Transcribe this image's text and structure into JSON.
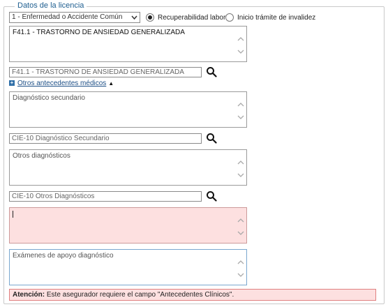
{
  "section": {
    "title": "Datos de la licencia"
  },
  "license_type": {
    "selected": "1 - Enfermedad o Accidente Común"
  },
  "radios": [
    {
      "label": "Recuperabilidad laboral",
      "checked": true
    },
    {
      "label": "Inicio trámite de invalidez",
      "checked": false
    }
  ],
  "primary_diagnosis": {
    "text": "F41.1 - TRASTORNO DE ANSIEDAD GENERALIZADA",
    "cie_input_value": "F41.1 - TRASTORNO DE ANSIEDAD GENERALIZADA"
  },
  "other_medical_history": {
    "link_label": "Otros antecedentes médicos"
  },
  "secondary_diagnosis": {
    "placeholder": "Diagnóstico secundario",
    "cie_placeholder": "CIE-10 Diagnóstico Secundario"
  },
  "other_diagnoses": {
    "placeholder": "Otros diagnósticos",
    "cie_placeholder": "CIE-10 Otros Diagnósticos"
  },
  "clinical_history": {
    "value": ""
  },
  "support_exams": {
    "placeholder": "Exámenes de apoyo diagnóstico"
  },
  "alert": {
    "label": "Atención:",
    "message": "Este asegurador requiere el campo \"Antecedentes Clínicos\"."
  },
  "colors": {
    "legend": "#1d5d8f",
    "error_bg": "#fde0e0",
    "error_border": "#e08080",
    "link": "#1d4f86"
  }
}
